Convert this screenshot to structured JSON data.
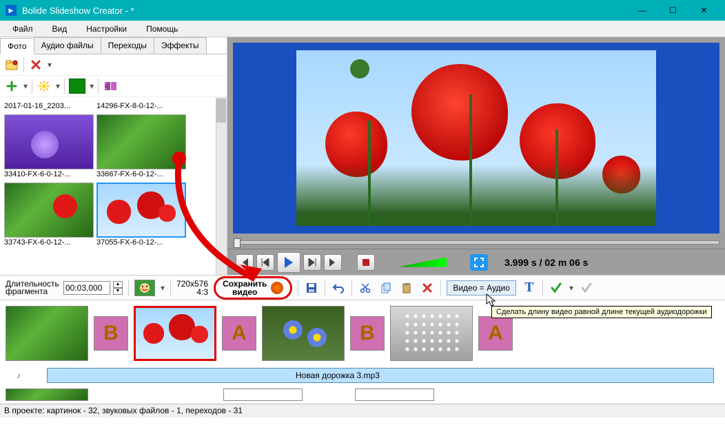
{
  "window": {
    "title": "Bolide Slideshow Creator - *"
  },
  "menu": {
    "file": "Файл",
    "view": "Вид",
    "settings": "Настройки",
    "help": "Помощь"
  },
  "tabs": {
    "photo": "Фото",
    "audio": "Аудио файлы",
    "transitions": "Переходы",
    "effects": "Эффекты"
  },
  "thumbs": {
    "t1": "2017-01-16_2203...",
    "t2": "14296-FX-8-0-12-...",
    "t3": "33410-FX-6-0-12-...",
    "t4": "33667-FX-6-0-12-...",
    "t5": "33743-FX-6-0-12-...",
    "t6": "37055-FX-6-0-12-..."
  },
  "playback": {
    "time": "3.999 s  / 02 m 06 s"
  },
  "fragment": {
    "label": "Длительность фрагмента",
    "value": "00:03,000",
    "resolution": "720x576",
    "aspect": "4:3"
  },
  "save_video": {
    "line1": "Сохранить",
    "line2": "видео"
  },
  "video_audio_btn": "Видео = Аудио",
  "tooltip": "Сделать длину видео равной длине текущей аудиодорожки",
  "audio": {
    "track": "Новая дорожка 3.mp3"
  },
  "transitions_row": {
    "b": "B",
    "a": "A"
  },
  "status": "В проекте: картинок - 32, звуковых файлов - 1, переходов - 31"
}
